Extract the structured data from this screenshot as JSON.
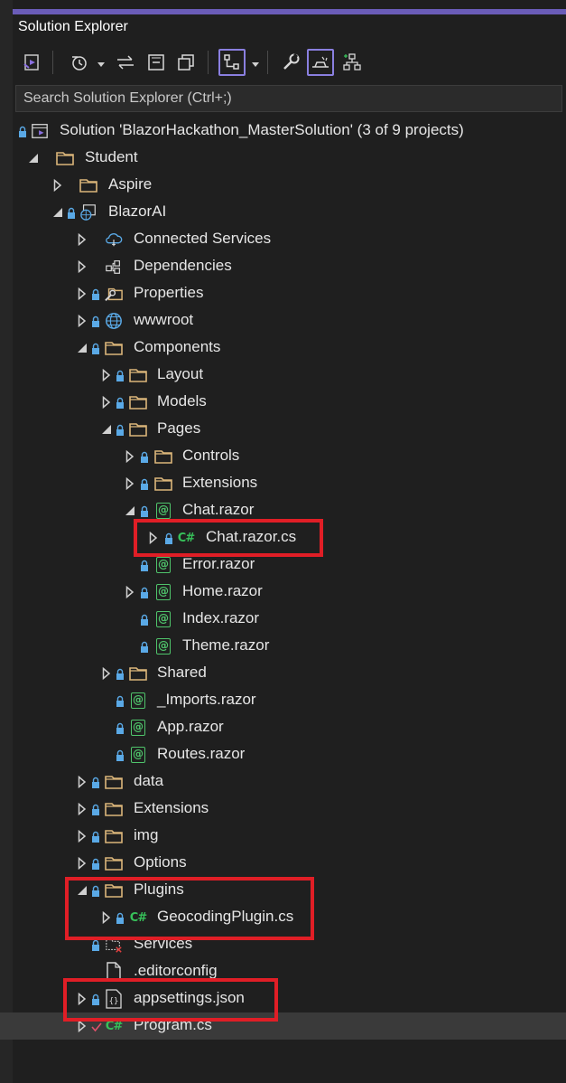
{
  "panel": {
    "title": "Solution Explorer"
  },
  "search": {
    "placeholder": "Search Solution Explorer (Ctrl+;)"
  },
  "colors": {
    "accent": "#6a5cb8",
    "highlight": "#e01e26",
    "folder": "#dcb67a",
    "csharp": "#37c15a",
    "lock": "#5aa9e6"
  },
  "tree": {
    "solution": "Solution 'BlazorHackathon_MasterSolution' (3 of 9 projects)",
    "student": "Student",
    "aspire": "Aspire",
    "blazorai": "BlazorAI",
    "connected_services": "Connected Services",
    "dependencies": "Dependencies",
    "properties": "Properties",
    "wwwroot": "wwwroot",
    "components": "Components",
    "layout": "Layout",
    "models": "Models",
    "pages": "Pages",
    "controls": "Controls",
    "extensions_pages": "Extensions",
    "chat_razor": "Chat.razor",
    "chat_razor_cs": "Chat.razor.cs",
    "error_razor": "Error.razor",
    "home_razor": "Home.razor",
    "index_razor": "Index.razor",
    "theme_razor": "Theme.razor",
    "shared": "Shared",
    "imports_razor": "_Imports.razor",
    "app_razor": "App.razor",
    "routes_razor": "Routes.razor",
    "data": "data",
    "extensions": "Extensions",
    "img": "img",
    "options": "Options",
    "plugins": "Plugins",
    "geocoding_plugin": "GeocodingPlugin.cs",
    "services": "Services",
    "editorconfig": ".editorconfig",
    "appsettings": "appsettings.json",
    "program": "Program.cs"
  }
}
